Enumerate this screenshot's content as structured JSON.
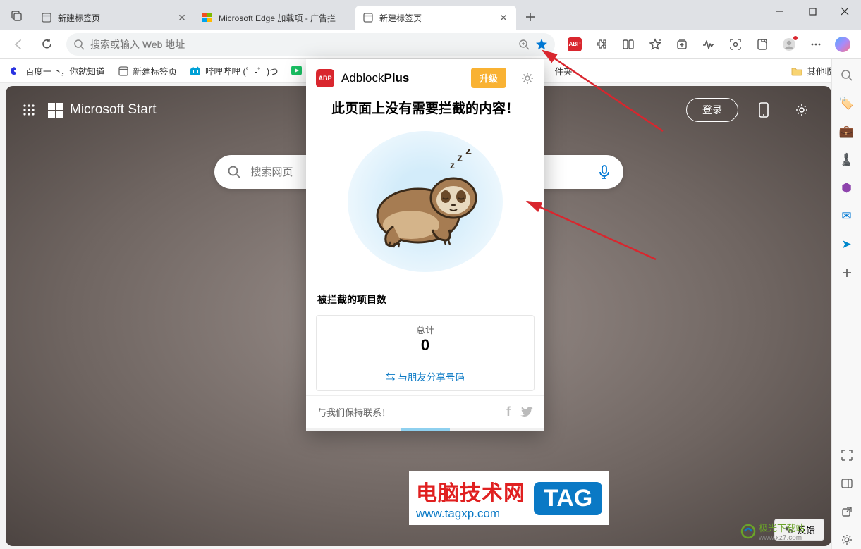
{
  "tabs": [
    {
      "label": "新建标签页"
    },
    {
      "label": "Microsoft Edge 加载项 - 广告拦"
    },
    {
      "label": "新建标签页"
    }
  ],
  "addressbar": {
    "placeholder": "搜索或输入 Web 地址"
  },
  "bookmarks": {
    "items": [
      {
        "label": "百度一下，你就知道"
      },
      {
        "label": "新建标签页"
      },
      {
        "label": "哔哩哔哩 (゜-゜)つ"
      }
    ],
    "partial_label": "件夹",
    "other": "其他收藏夹"
  },
  "ntp": {
    "brand": "Microsoft Start",
    "login": "登录",
    "search_placeholder": "搜索网页",
    "feedback": "反馈"
  },
  "abp": {
    "brand_pre": "Adblock",
    "brand_bold": "Plus",
    "upgrade": "升级",
    "message": "此页面上没有需要拦截的内容！",
    "stats_label": "被拦截的项目数",
    "total_label": "总计",
    "total_value": "0",
    "share": "与朋友分享号码",
    "contact": "与我们保持联系！"
  },
  "watermark": {
    "cn": "电脑技术网",
    "url": "www.tagxp.com",
    "tag": "TAG"
  },
  "jiguang": {
    "name": "极光下载站",
    "url": "www.xz7.com"
  }
}
